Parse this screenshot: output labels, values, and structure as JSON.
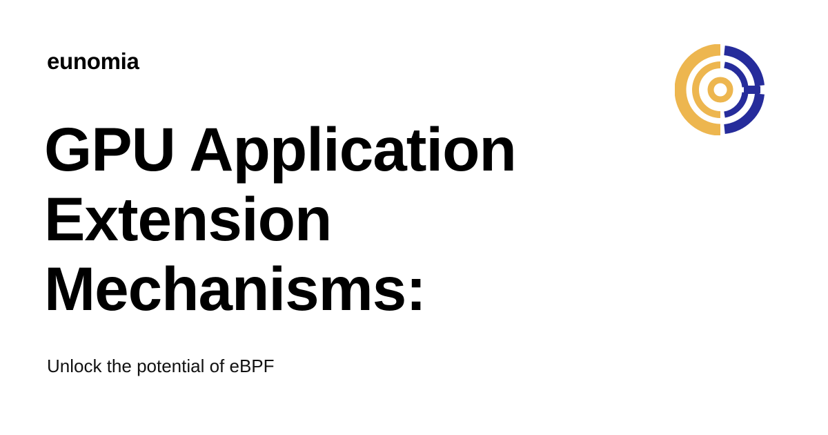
{
  "site": {
    "name": "eunomia"
  },
  "headline": {
    "lines": [
      "GPU Application",
      "Extension",
      "Mechanisms:"
    ]
  },
  "tagline": "Unlock the potential of eBPF",
  "logo": {
    "icon": "eunomia-logo-icon",
    "colors": {
      "gold": "#EDB64F",
      "navy": "#262C9B"
    }
  }
}
